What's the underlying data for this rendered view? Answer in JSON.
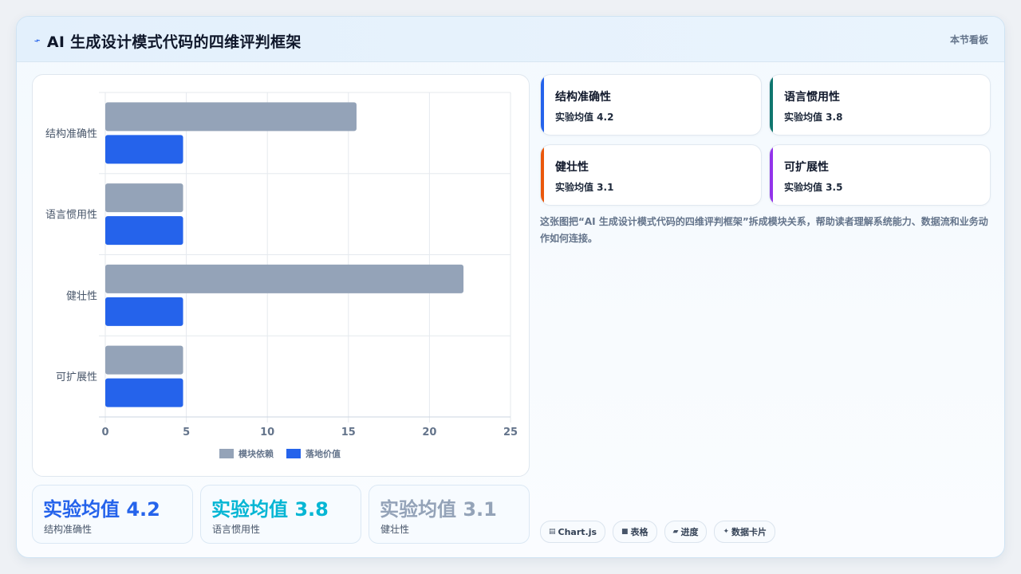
{
  "header": {
    "title": "AI 生成设计模式代码的四维评判框架",
    "right_label": "本节看板"
  },
  "chart_data": {
    "type": "bar",
    "orientation": "horizontal",
    "categories": [
      "结构准确性",
      "语言惯用性",
      "健壮性",
      "可扩展性"
    ],
    "series": [
      {
        "name": "模块依赖",
        "values": [
          15.5,
          4.8,
          22.1,
          4.8
        ],
        "color": "#94a3b8"
      },
      {
        "name": "落地价值",
        "values": [
          4.8,
          4.8,
          4.8,
          4.8
        ],
        "color": "#2563eb"
      }
    ],
    "xlim": [
      0,
      25
    ],
    "xticks": [
      "0",
      "5",
      "10",
      "15",
      "20",
      "25"
    ],
    "grid": true,
    "legend_position": "bottom"
  },
  "stats": [
    {
      "value": "实验均值 4.2",
      "label": "结构准确性",
      "color": "#2563eb"
    },
    {
      "value": "实验均值 3.8",
      "label": "语言惯用性",
      "color": "#06b6d4"
    },
    {
      "value": "实验均值 3.1",
      "label": "健壮性",
      "color": "#94a3b8"
    }
  ],
  "dimensions": [
    {
      "name": "结构准确性",
      "metric": "实验均值 4.2",
      "accent": "#2563eb"
    },
    {
      "name": "语言惯用性",
      "metric": "实验均值 3.8",
      "accent": "#0f766e"
    },
    {
      "name": "健壮性",
      "metric": "实验均值 3.1",
      "accent": "#ea580c"
    },
    {
      "name": "可扩展性",
      "metric": "实验均值 3.5",
      "accent": "#9333ea"
    }
  ],
  "description": "这张图把“AI 生成设计模式代码的四维评判框架”拆成模块关系，帮助读者理解系统能力、数据流和业务动作如何连接。",
  "tags": [
    {
      "icon": "chart-icon",
      "label": "Chart.js"
    },
    {
      "icon": "table-icon",
      "label": "表格"
    },
    {
      "icon": "progress-icon",
      "label": "进度"
    },
    {
      "icon": "card-icon",
      "label": "数据卡片"
    }
  ]
}
